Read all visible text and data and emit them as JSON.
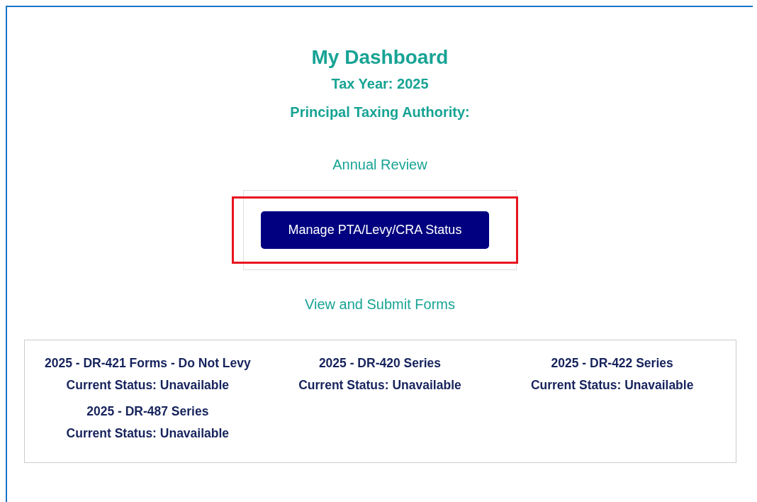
{
  "header": {
    "title": "My Dashboard",
    "tax_year": "Tax Year: 2025",
    "authority": "Principal Taxing Authority:"
  },
  "annual_review": {
    "heading": "Annual Review",
    "button": {
      "label": "Manage PTA/Levy/CRA Status",
      "highlighted": true
    }
  },
  "forms_section": {
    "heading": "View and Submit Forms",
    "forms": [
      {
        "title": "2025 - DR-421 Forms - Do Not Levy",
        "status": "Current Status: Unavailable"
      },
      {
        "title": "2025 - DR-420 Series",
        "status": "Current Status: Unavailable"
      },
      {
        "title": "2025 - DR-422 Series",
        "status": "Current Status: Unavailable"
      },
      {
        "title": "2025 - DR-487 Series",
        "status": "Current Status: Unavailable"
      }
    ]
  }
}
